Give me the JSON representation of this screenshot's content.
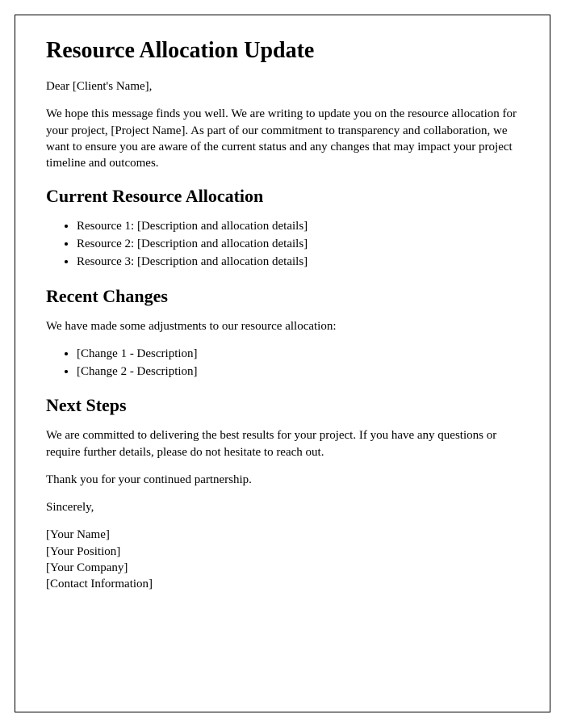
{
  "title": "Resource Allocation Update",
  "greeting": "Dear [Client's Name],",
  "intro": "We hope this message finds you well. We are writing to update you on the resource allocation for your project, [Project Name]. As part of our commitment to transparency and collaboration, we want to ensure you are aware of the current status and any changes that may impact your project timeline and outcomes.",
  "section1": {
    "heading": "Current Resource Allocation",
    "items": [
      "Resource 1: [Description and allocation details]",
      "Resource 2: [Description and allocation details]",
      "Resource 3: [Description and allocation details]"
    ]
  },
  "section2": {
    "heading": "Recent Changes",
    "intro": "We have made some adjustments to our resource allocation:",
    "items": [
      "[Change 1 - Description]",
      "[Change 2 - Description]"
    ]
  },
  "section3": {
    "heading": "Next Steps",
    "p1": "We are committed to delivering the best results for your project. If you have any questions or require further details, please do not hesitate to reach out.",
    "p2": "Thank you for your continued partnership."
  },
  "closing": "Sincerely,",
  "signature": {
    "name": "[Your Name]",
    "position": "[Your Position]",
    "company": "[Your Company]",
    "contact": "[Contact Information]"
  }
}
